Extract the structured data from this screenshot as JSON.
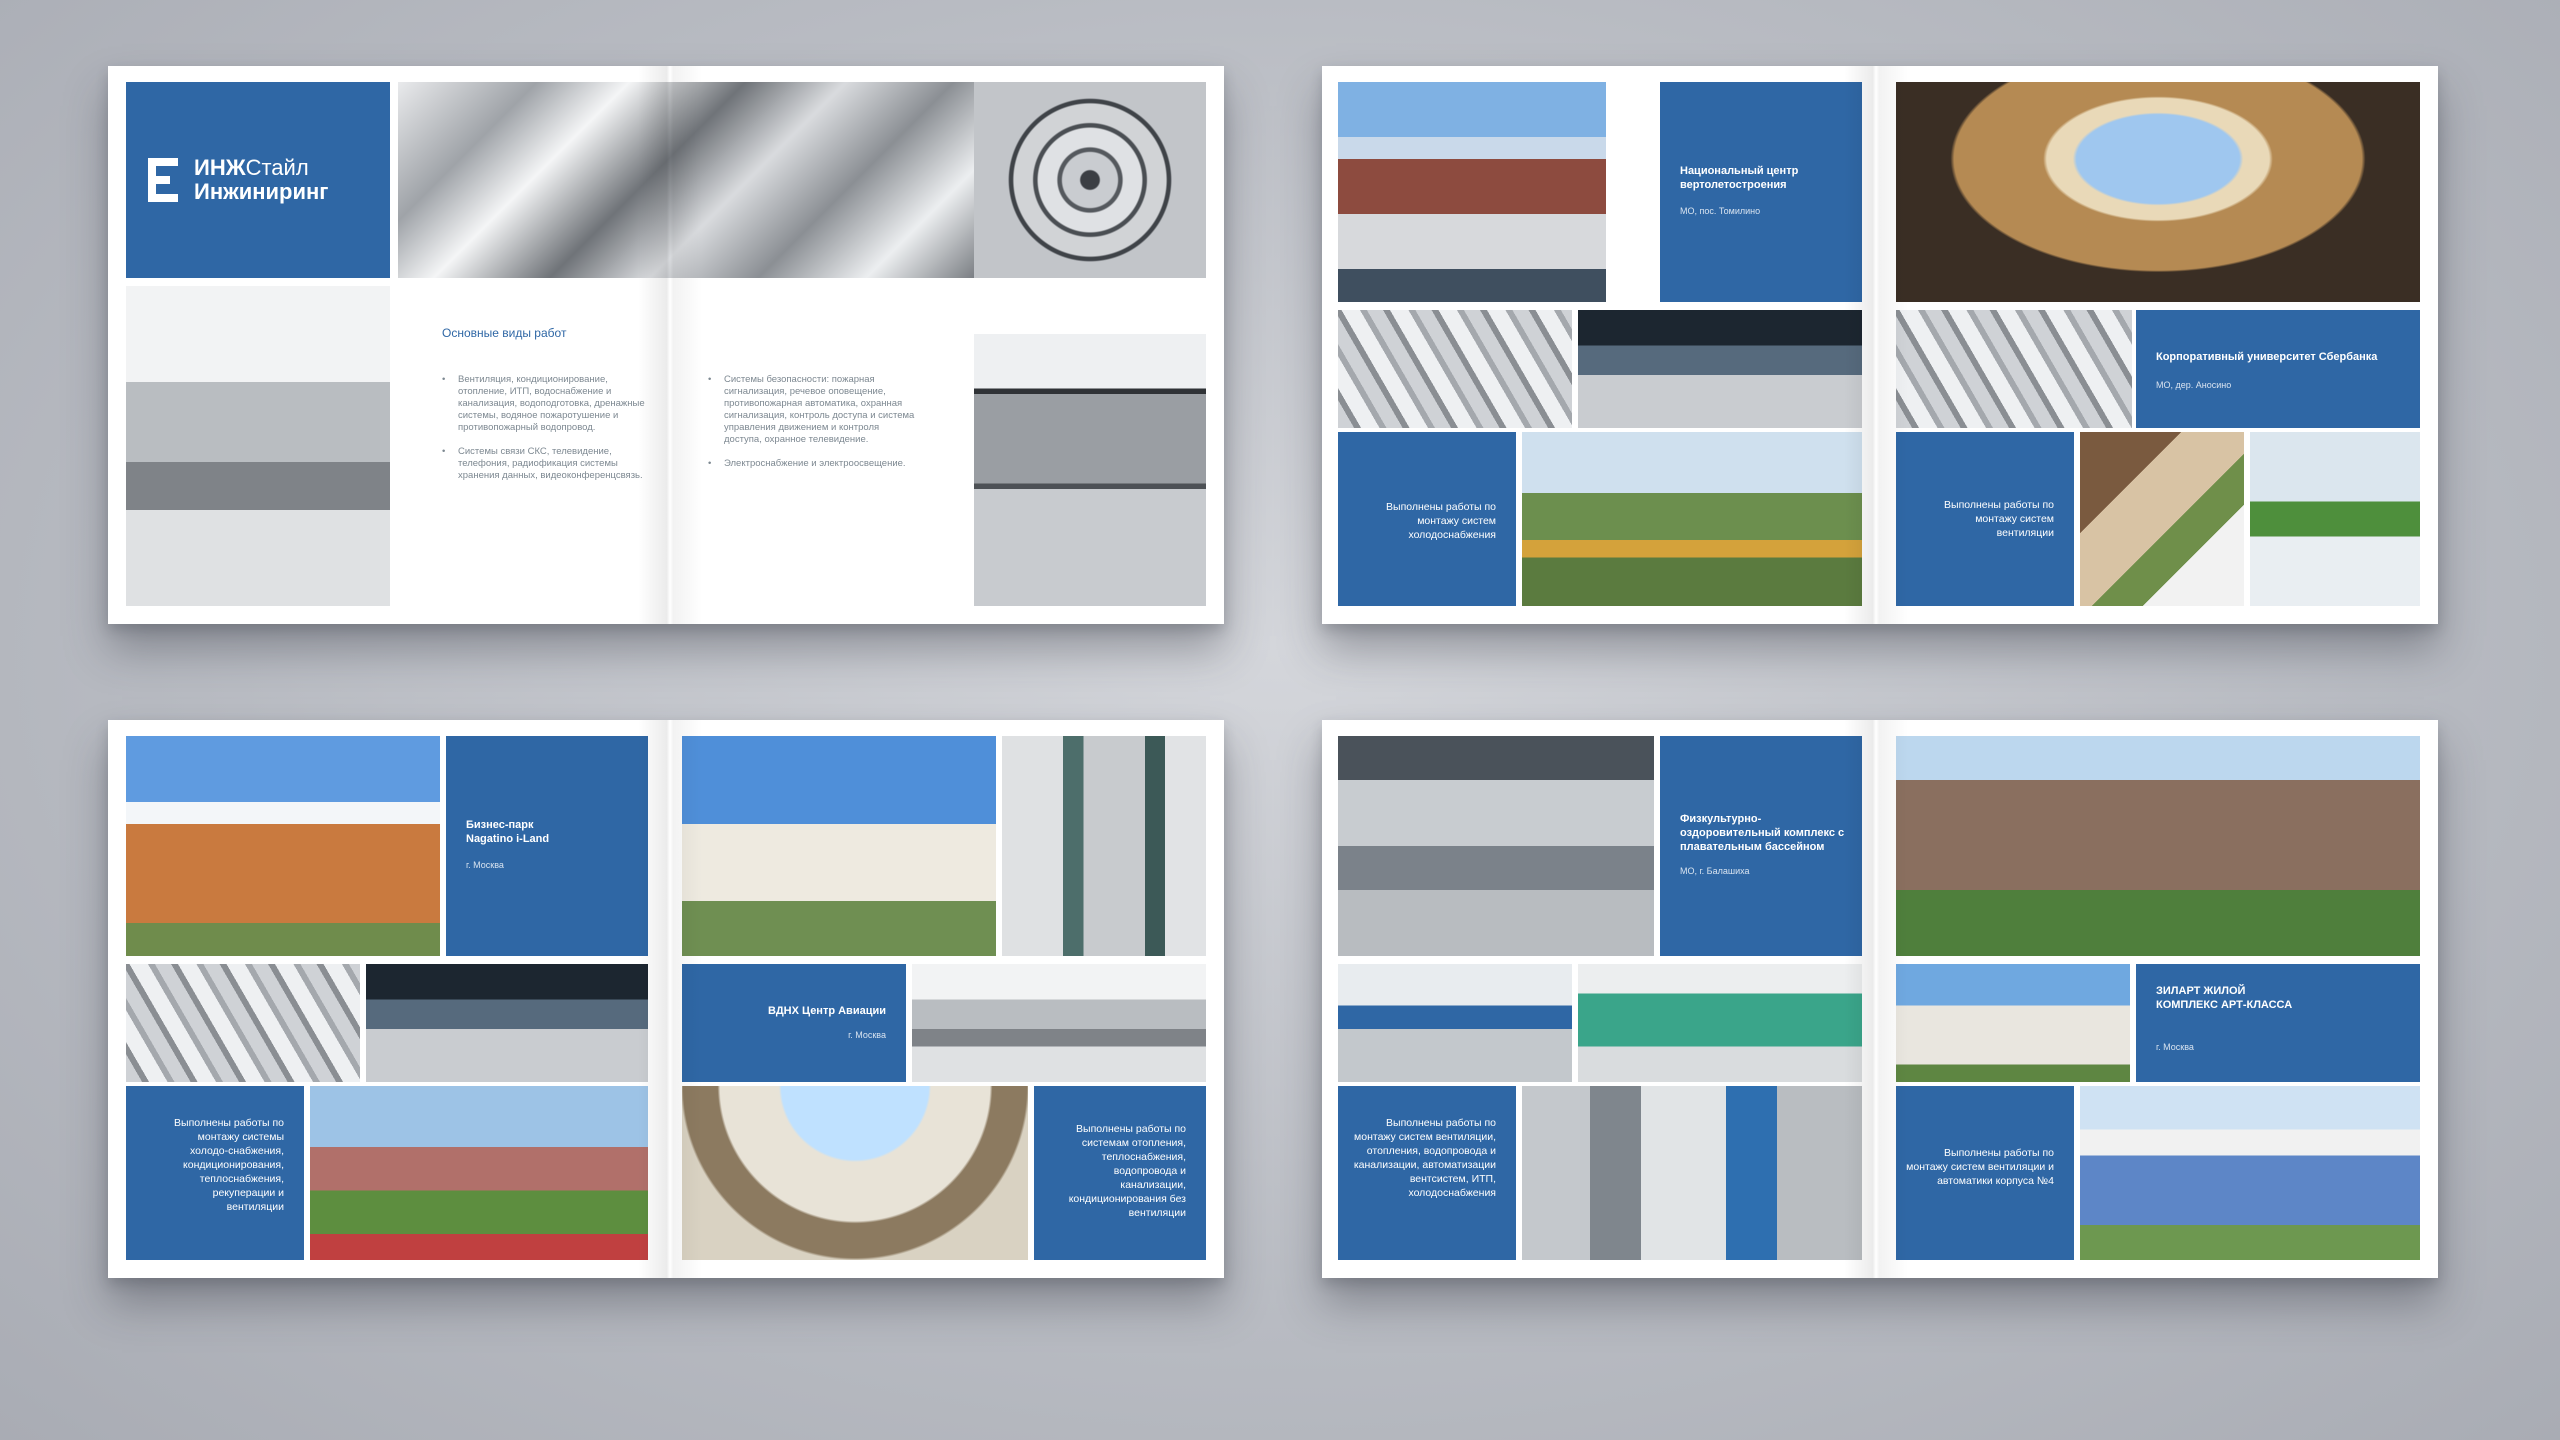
{
  "brand": {
    "line1_bold": "ИНЖ",
    "line1_rest": "Стайл",
    "line2": "Инжиниринг"
  },
  "spread1": {
    "heading": "Основные виды работ",
    "col1": [
      "Вентиляция, кондиционирование, отопление, ИТП, водоснабжение и канализация, водоподготовка, дренажные системы, водяное пожаротушение и противопожарный водопровод.",
      "Системы связи СКС, телевидение, телефония, радиофикация системы хранения данных, видеоконференцсвязь."
    ],
    "col2": [
      "Системы безопасности: пожарная сигнализация, речевое оповещение, противопожарная автоматика, охранная сигнализация, контроль доступа и система управления движением и контроля доступа, охранное телевидение.",
      "Электроснабжение и электроосвещение."
    ]
  },
  "spread2": {
    "left": {
      "title": "Национальный центр вертолетостроения",
      "location": "МО, пос. Томилино",
      "done": "Выполнены работы по монтажу систем холодоснабжения"
    },
    "right": {
      "title": "Корпоративный университет Сбербанка",
      "location": "МО, дер. Аносино",
      "done": "Выполнены работы по монтажу систем вентиляции"
    }
  },
  "spread3": {
    "left": {
      "title": "Бизнес-парк Nagatino i-Land",
      "location": "г. Москва",
      "done": "Выполнены работы по монтажу системы холодо-снабжения, кондиционирования, теплоснабжения, рекуперации и вентиляции"
    },
    "right": {
      "title": "ВДНХ Центр Авиации",
      "location": "г. Москва",
      "done": "Выполнены работы по системам отопления, теплоснабжения, водопровода и канализации, кондиционирования без вентиляции"
    }
  },
  "spread4": {
    "left": {
      "title": "Физкультурно-оздоровительный комплекс с плавательным бассейном",
      "location": "МО, г. Балашиха",
      "done": "Выполнены работы по монтажу систем вентиляции, отопления, водопровода и канализации, автоматизации вентсистем, ИТП, холодоснабжения"
    },
    "right": {
      "title": "ЗИЛАРТ ЖИЛОЙ КОМПЛЕКС АРТ-КЛАССА",
      "location": "г. Москва",
      "done": "Выполнены работы по монтажу систем вентиляции и автоматики корпуса №4"
    }
  },
  "colors": {
    "brand_blue": "#2f67a5",
    "background": "#b8bbc2"
  }
}
